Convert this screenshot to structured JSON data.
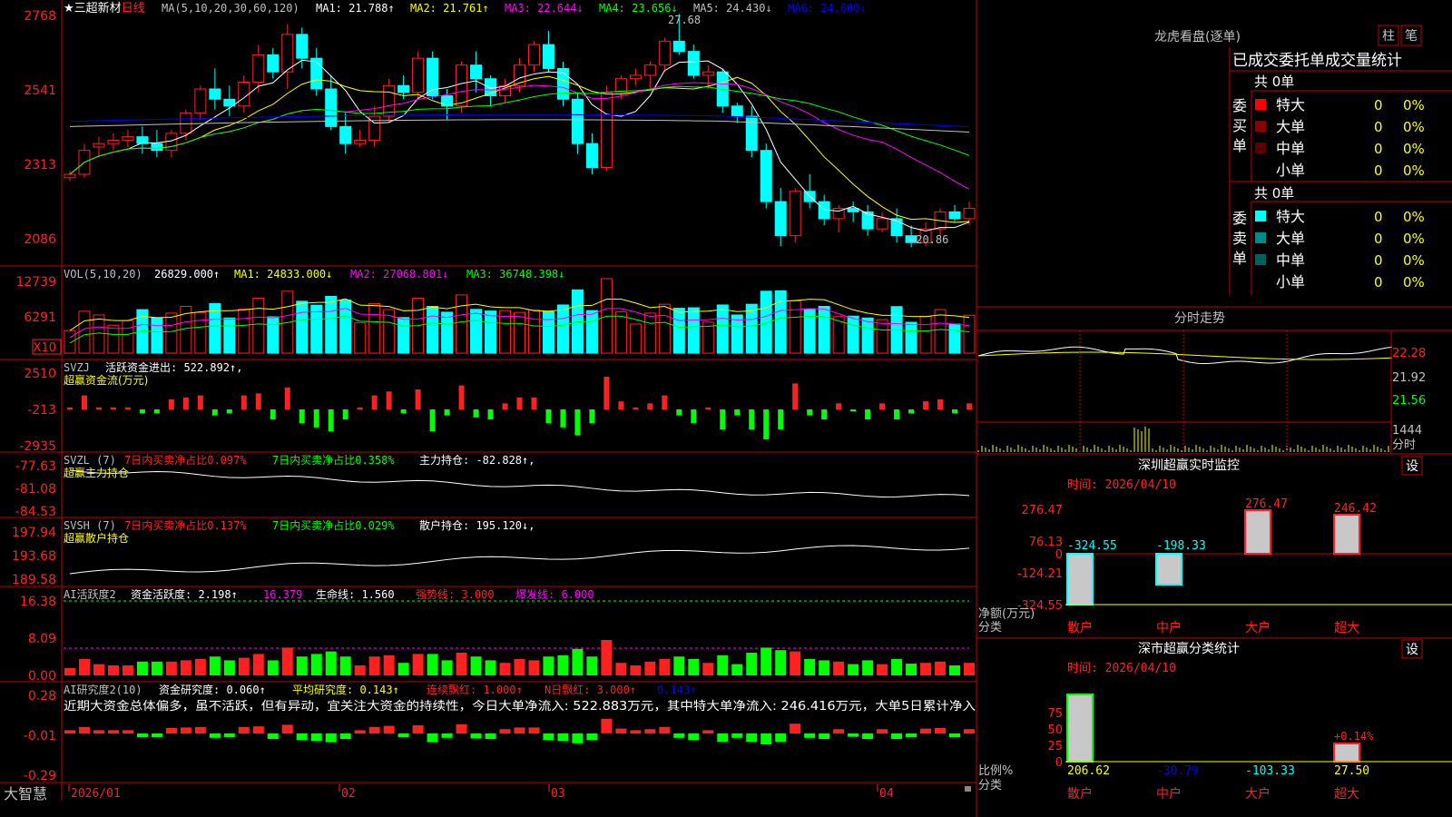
{
  "colors": {
    "up": "#ff2020",
    "down": "#00ffff",
    "grid": "#c00000",
    "ma1": "#ffffff",
    "ma2": "#ffff00",
    "ma3": "#ff00ff",
    "ma4": "#00ff00",
    "ma5": "#c0c0c0",
    "ma6": "#0000ff",
    "vma1": "#ffff00",
    "vma2": "#ff00ff",
    "vma3": "#00ff00",
    "lime": "#00ff00",
    "mag": "#ff00ff"
  },
  "header": {
    "star": "★",
    "name": "三超新材",
    "period": "日线",
    "ma_params": "MA(5,10,20,30,60,120)",
    "ma1": "MA1: 21.788↑",
    "ma2": "MA2: 21.761↑",
    "ma3": "MA3: 22.644↓",
    "ma4": "MA4: 23.656↓",
    "ma5": "MA5: 24.430↓",
    "ma6": "MA6: 24.600↓"
  },
  "price_axis": [
    "2768",
    "2541",
    "2313",
    "2086"
  ],
  "high_label": "27.68",
  "low_label": "←20.86",
  "vol": {
    "title": "VOL(5,10,20)",
    "value": "26829.000↑",
    "ma1": "MA1: 24833.000↓",
    "ma2": "MA2: 27068.801↓",
    "ma3": "MA3: 36748.398↓",
    "axis": [
      "12739",
      "6291"
    ],
    "unit": "X10"
  },
  "svzj": {
    "title": "SVZJ",
    "label": "活跃资金进出: 522.892↑,",
    "sub": "超赢资金流(万元)",
    "axis": [
      "2510",
      "-213",
      "-2935"
    ]
  },
  "svzl": {
    "title": "SVZL (7)",
    "a": "7日内买卖净占比0.097%",
    "b": "7日内买卖净占比0.358%",
    "c": "主力持仓: -82.828↑,",
    "sub": "超赢主力持仓",
    "axis": [
      "-77.63",
      "-81.08",
      "-84.53"
    ]
  },
  "svsh": {
    "title": "SVSH (7)",
    "a": "7日内买卖净占比0.137%",
    "b": "7日内买卖净占比0.029%",
    "c": "散户持仓: 195.120↓,",
    "sub": "超赢散户持仓",
    "axis": [
      "197.94",
      "193.68",
      "189.58"
    ]
  },
  "ai1": {
    "title": "AI活跃度2",
    "a": "资金活跃度: 2.198↑",
    "b": "16.379",
    "c": "生命线: 1.560",
    "d": "强势线: 3.000",
    "e": "爆发线: 6.000",
    "axis": [
      "16.38",
      "8.09",
      "0.00"
    ]
  },
  "ai2": {
    "title": "AI研究度2(10)",
    "a": "资金研究度: 0.060↑",
    "b": "平均研究度: 0.143↑",
    "c": "连续飘红: 1.000↑",
    "d": "N日飘红: 3.000↑",
    "e": "0.143↑",
    "note": "近期大资金总体偏多，虽不活跃，但有异动，宜关注大资金的持续性，今日大单净流入: 522.883万元，其中特大单净流入: 246.416万元，大单5日累计净入",
    "axis": [
      "0.28",
      "-0.01",
      "-0.29"
    ]
  },
  "dates": {
    "d1": "2026/01",
    "d2": "02",
    "d3": "03",
    "d4": "04"
  },
  "brand": "大智慧",
  "lhb": {
    "title": "龙虎看盘(逐单)",
    "btn1": "柱",
    "btn2": "笔",
    "header": "已成交委托单成交量统计",
    "buy_side": "委买单",
    "sell_side": "委卖单",
    "buy_total": "共 0单",
    "sell_total": "共 0单",
    "rows": [
      {
        "label": "特大",
        "val": "0",
        "pct": "0%"
      },
      {
        "label": "大单",
        "val": "0",
        "pct": "0%"
      },
      {
        "label": "中单",
        "val": "0",
        "pct": "0%"
      },
      {
        "label": "小单",
        "val": "0",
        "pct": "0%"
      }
    ]
  },
  "fenshi": {
    "title": "分时走势",
    "axis": [
      "22.28",
      "21.92",
      "21.56",
      "1444",
      "分时"
    ]
  },
  "sz": {
    "title": "深圳超赢实时监控",
    "btn": "设",
    "time": "时间: 2026/04/10",
    "ylabel": "净额(万元)",
    "xlabel": "分类",
    "axis": [
      "276.47",
      "76.13",
      "0",
      "-124.21",
      "-324.55"
    ],
    "cats": [
      "散户",
      "中户",
      "大户",
      "超大"
    ],
    "labels": [
      "-324.55",
      "-198.33",
      "276.47",
      "246.42"
    ]
  },
  "ss": {
    "title": "深市超赢分类统计",
    "btn": "设",
    "time": "时间: 2026/04/10",
    "ylabel": "比例%",
    "xlabel": "分类",
    "axis": [
      "75",
      "50",
      "25",
      "0"
    ],
    "cats": [
      "散户",
      "中户",
      "大户",
      "超大"
    ],
    "vals": [
      "206.62",
      "-30.79",
      "-103.33",
      "27.50"
    ],
    "note": "+0.14%"
  },
  "chart_data": {
    "type": "candlestick",
    "x": [
      "2026/01",
      "02",
      "03",
      "04"
    ],
    "ohlc": [
      [
        22.9,
        23.1,
        22.8,
        23.0
      ],
      [
        23.0,
        23.9,
        22.9,
        23.7
      ],
      [
        23.8,
        24.1,
        23.5,
        23.9
      ],
      [
        23.9,
        24.2,
        23.7,
        24.0
      ],
      [
        24.0,
        24.3,
        23.8,
        24.1
      ],
      [
        24.1,
        24.4,
        23.6,
        23.9
      ],
      [
        23.9,
        24.3,
        23.5,
        23.7
      ],
      [
        23.7,
        24.3,
        23.5,
        24.2
      ],
      [
        24.2,
        24.9,
        24.0,
        24.8
      ],
      [
        24.8,
        25.6,
        24.6,
        25.5
      ],
      [
        25.5,
        26.1,
        24.9,
        25.2
      ],
      [
        25.2,
        25.6,
        24.7,
        25.0
      ],
      [
        25.0,
        25.9,
        24.8,
        25.7
      ],
      [
        25.7,
        26.8,
        25.4,
        26.5
      ],
      [
        26.5,
        26.7,
        25.8,
        26.0
      ],
      [
        26.0,
        27.4,
        25.5,
        27.1
      ],
      [
        27.1,
        27.3,
        26.1,
        26.4
      ],
      [
        26.4,
        26.7,
        25.3,
        25.5
      ],
      [
        25.5,
        25.9,
        24.3,
        24.4
      ],
      [
        24.4,
        24.8,
        23.6,
        23.9
      ],
      [
        23.9,
        24.3,
        23.8,
        24.0
      ],
      [
        24.0,
        25.0,
        23.8,
        24.7
      ],
      [
        24.7,
        25.8,
        24.5,
        25.6
      ],
      [
        25.6,
        25.9,
        25.2,
        25.4
      ],
      [
        25.4,
        26.6,
        25.2,
        26.4
      ],
      [
        26.4,
        26.6,
        25.2,
        25.3
      ],
      [
        25.3,
        25.5,
        24.6,
        25.0
      ],
      [
        25.0,
        26.3,
        24.8,
        26.2
      ],
      [
        26.2,
        26.6,
        25.4,
        25.8
      ],
      [
        25.8,
        25.9,
        25.0,
        25.3
      ],
      [
        25.3,
        25.8,
        25.1,
        25.6
      ],
      [
        25.6,
        26.4,
        25.4,
        26.2
      ],
      [
        26.2,
        26.9,
        26.0,
        26.8
      ],
      [
        26.8,
        27.2,
        26.0,
        26.1
      ],
      [
        26.1,
        26.3,
        25.0,
        25.2
      ],
      [
        25.2,
        25.4,
        23.6,
        23.9
      ],
      [
        23.9,
        24.2,
        23.0,
        23.2
      ],
      [
        23.2,
        25.6,
        23.1,
        25.4
      ],
      [
        25.4,
        25.9,
        25.2,
        25.8
      ],
      [
        25.8,
        26.1,
        25.6,
        25.9
      ],
      [
        25.9,
        26.3,
        25.5,
        26.2
      ],
      [
        26.2,
        27.0,
        26.0,
        26.9
      ],
      [
        26.9,
        27.7,
        26.5,
        26.6
      ],
      [
        26.6,
        26.8,
        25.8,
        25.9
      ],
      [
        25.9,
        26.2,
        25.5,
        26.0
      ],
      [
        26.0,
        26.1,
        24.8,
        25.0
      ],
      [
        25.0,
        25.1,
        24.5,
        24.7
      ],
      [
        24.7,
        25.0,
        23.5,
        23.7
      ],
      [
        23.7,
        23.9,
        22.0,
        22.2
      ],
      [
        22.2,
        22.6,
        20.9,
        21.2
      ],
      [
        21.2,
        22.6,
        21.0,
        22.5
      ],
      [
        22.5,
        23.0,
        22.0,
        22.2
      ],
      [
        22.2,
        22.4,
        21.5,
        21.7
      ],
      [
        21.7,
        22.1,
        21.3,
        22.0
      ],
      [
        22.0,
        22.2,
        21.6,
        21.9
      ],
      [
        21.9,
        22.1,
        21.2,
        21.4
      ],
      [
        21.4,
        21.9,
        21.3,
        21.7
      ],
      [
        21.7,
        22.0,
        21.0,
        21.2
      ],
      [
        21.2,
        21.5,
        20.86,
        21.0
      ],
      [
        21.0,
        21.6,
        20.9,
        21.4
      ],
      [
        21.4,
        22.0,
        21.2,
        21.9
      ],
      [
        21.9,
        22.1,
        21.6,
        21.7
      ],
      [
        21.7,
        22.2,
        21.5,
        22.0
      ]
    ],
    "ylim": [
      20.5,
      28.0
    ]
  }
}
